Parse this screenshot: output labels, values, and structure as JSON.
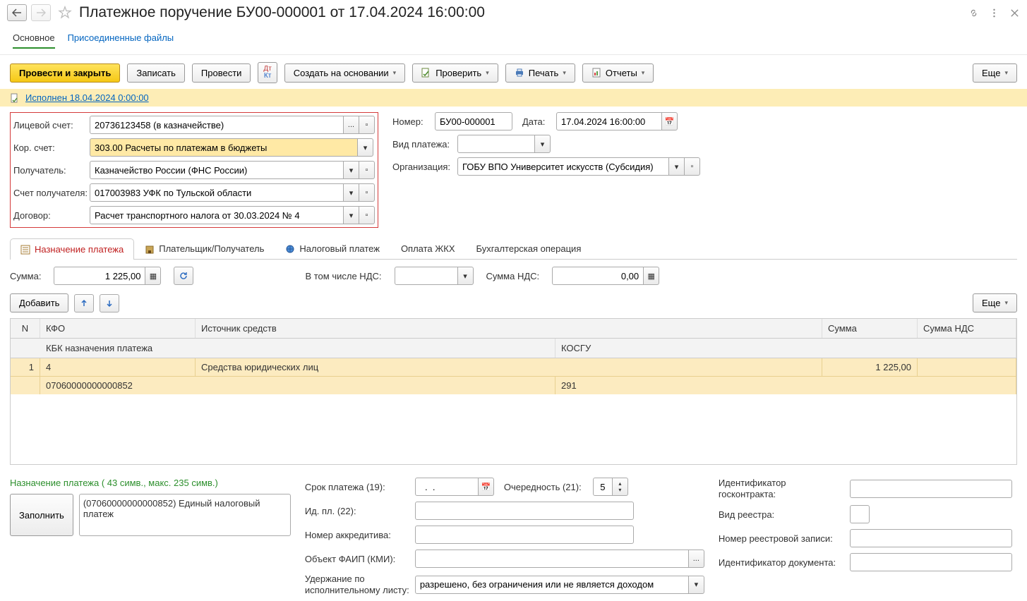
{
  "header": {
    "title": "Платежное поручение БУ00-000001 от 17.04.2024 16:00:00"
  },
  "subnav": {
    "main": "Основное",
    "attached": "Присоединенные файлы"
  },
  "toolbar": {
    "post_close": "Провести и закрыть",
    "save": "Записать",
    "post": "Провести",
    "create_based": "Создать на основании",
    "check": "Проверить",
    "print": "Печать",
    "reports": "Отчеты",
    "more": "Еще"
  },
  "status": {
    "text": "Исполнен 18.04.2024 0:00:00"
  },
  "left_form": {
    "account_label": "Лицевой счет:",
    "account_value": "20736123458 (в казначействе)",
    "cor_label": "Кор. счет:",
    "cor_value": "303.00 Расчеты по платежам в бюджеты",
    "payee_label": "Получатель:",
    "payee_value": "Казначейство России (ФНС России)",
    "payee_acc_label": "Счет получателя:",
    "payee_acc_value": "017003983 УФК по Тульской области",
    "contract_label": "Договор:",
    "contract_value": "Расчет транспортного налога от 30.03.2024 № 4"
  },
  "right_form": {
    "number_label": "Номер:",
    "number_value": "БУ00-000001",
    "date_label": "Дата:",
    "date_value": "17.04.2024 16:00:00",
    "paytype_label": "Вид платежа:",
    "paytype_value": "",
    "org_label": "Организация:",
    "org_value": "ГОБУ ВПО Университет искусств (Субсидия)"
  },
  "tabs": {
    "purpose": "Назначение платежа",
    "payer": "Плательщик/Получатель",
    "tax": "Налоговый платеж",
    "jkh": "Оплата ЖКХ",
    "acc_op": "Бухгалтерская операция"
  },
  "sums": {
    "sum_label": "Сумма:",
    "sum_value": "1 225,00",
    "incl_nds_label": "В том числе НДС:",
    "nds_select": "",
    "nds_sum_label": "Сумма НДС:",
    "nds_sum_value": "0,00"
  },
  "grid_toolbar": {
    "add": "Добавить",
    "more": "Еще"
  },
  "grid": {
    "h_n": "N",
    "h_kfo": "КФО",
    "h_src": "Источник средств",
    "h_sum": "Сумма",
    "h_ndssum": "Сумма НДС",
    "h_kbk": "КБК назначения платежа",
    "h_kosgu": "КОСГУ",
    "row": {
      "n": "1",
      "kfo": "4",
      "src": "Средства юридических лиц",
      "sum": "1 225,00",
      "ndssum": "",
      "kbk": "07060000000000852",
      "kosgu": "291"
    }
  },
  "bottom": {
    "desc_label": "Назначение платежа ( 43 симв., макс. 235 симв.)",
    "fill_btn": "Заполнить",
    "desc_text": "(07060000000000852) Единый налоговый платеж",
    "term_label": "Срок платежа (19):",
    "term_value": "  .  .",
    "order_label": "Очередность (21):",
    "order_value": "5",
    "idpl_label": "Ид. пл. (22):",
    "accred_label": "Номер аккредитива:",
    "faip_label": "Объект ФАИП (КМИ):",
    "hold_label": "Удержание по исполнительному листу:",
    "hold_value": "разрешено, без ограничения или не является доходом",
    "gos_id_label": "Идентификатор госконтракта:",
    "reg_type_label": "Вид реестра:",
    "reg_num_label": "Номер реестровой записи:",
    "doc_id_label": "Идентификатор документа:"
  }
}
